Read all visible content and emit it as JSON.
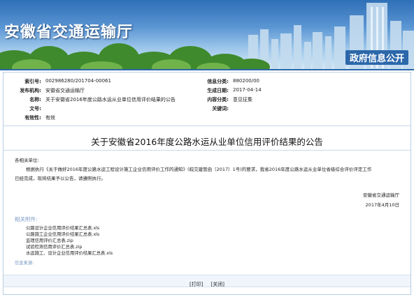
{
  "header": {
    "site_title": "安徽省交通运输厅",
    "gov_open": "政府信息公开"
  },
  "meta": {
    "index_no_label": "索引号:",
    "index_no": "002986280/201704-00061",
    "category_label": "信息分类:",
    "category": "880200/00",
    "publisher_label": "发布机构:",
    "publisher": "安徽省交通运输厅",
    "date_label": "生成日期:",
    "date": "2017-04-14",
    "name_label": "名称:",
    "name": "关于安徽省2016年度公路水运从业单位信用评价结果的公告",
    "content_label": "内容分类:",
    "content": "意见征集",
    "doc_no_label": "文号:",
    "doc_no": "",
    "keywords_label": "关键词:",
    "keywords": "",
    "validity_label": "有效性:",
    "validity": "有效"
  },
  "doc": {
    "title": "关于安徽省2016年度公路水运从业单位信用评价结果的公告",
    "salutation": "各相关单位:",
    "body1": "根据执行《关于做好2016年度公路水运工程设计施工企业信用评价工作的通知》(皖交建管函〔2017〕1号)的要求，我省2016年度公路水运从业单位省级综合评价评定工作",
    "body2": "已经完成，现将结果予以公告，请遵照执行。",
    "signer": "安徽省交通运输厅",
    "sign_date": "2017年4月10日"
  },
  "attachments": {
    "label": "相关附件:",
    "items": [
      "公路设计企业信用评价结果汇总表.xls",
      "公路施工企业信用评价结果汇总表.xls",
      "监理信用评价汇总表.zip",
      "试验检测信用评价汇总表.zip",
      "水运施工、设计企业信用评价结果汇总表.xls"
    ]
  },
  "source_label": "信息来源:",
  "actions": {
    "print": "[打印]",
    "close": "[关闭]"
  }
}
